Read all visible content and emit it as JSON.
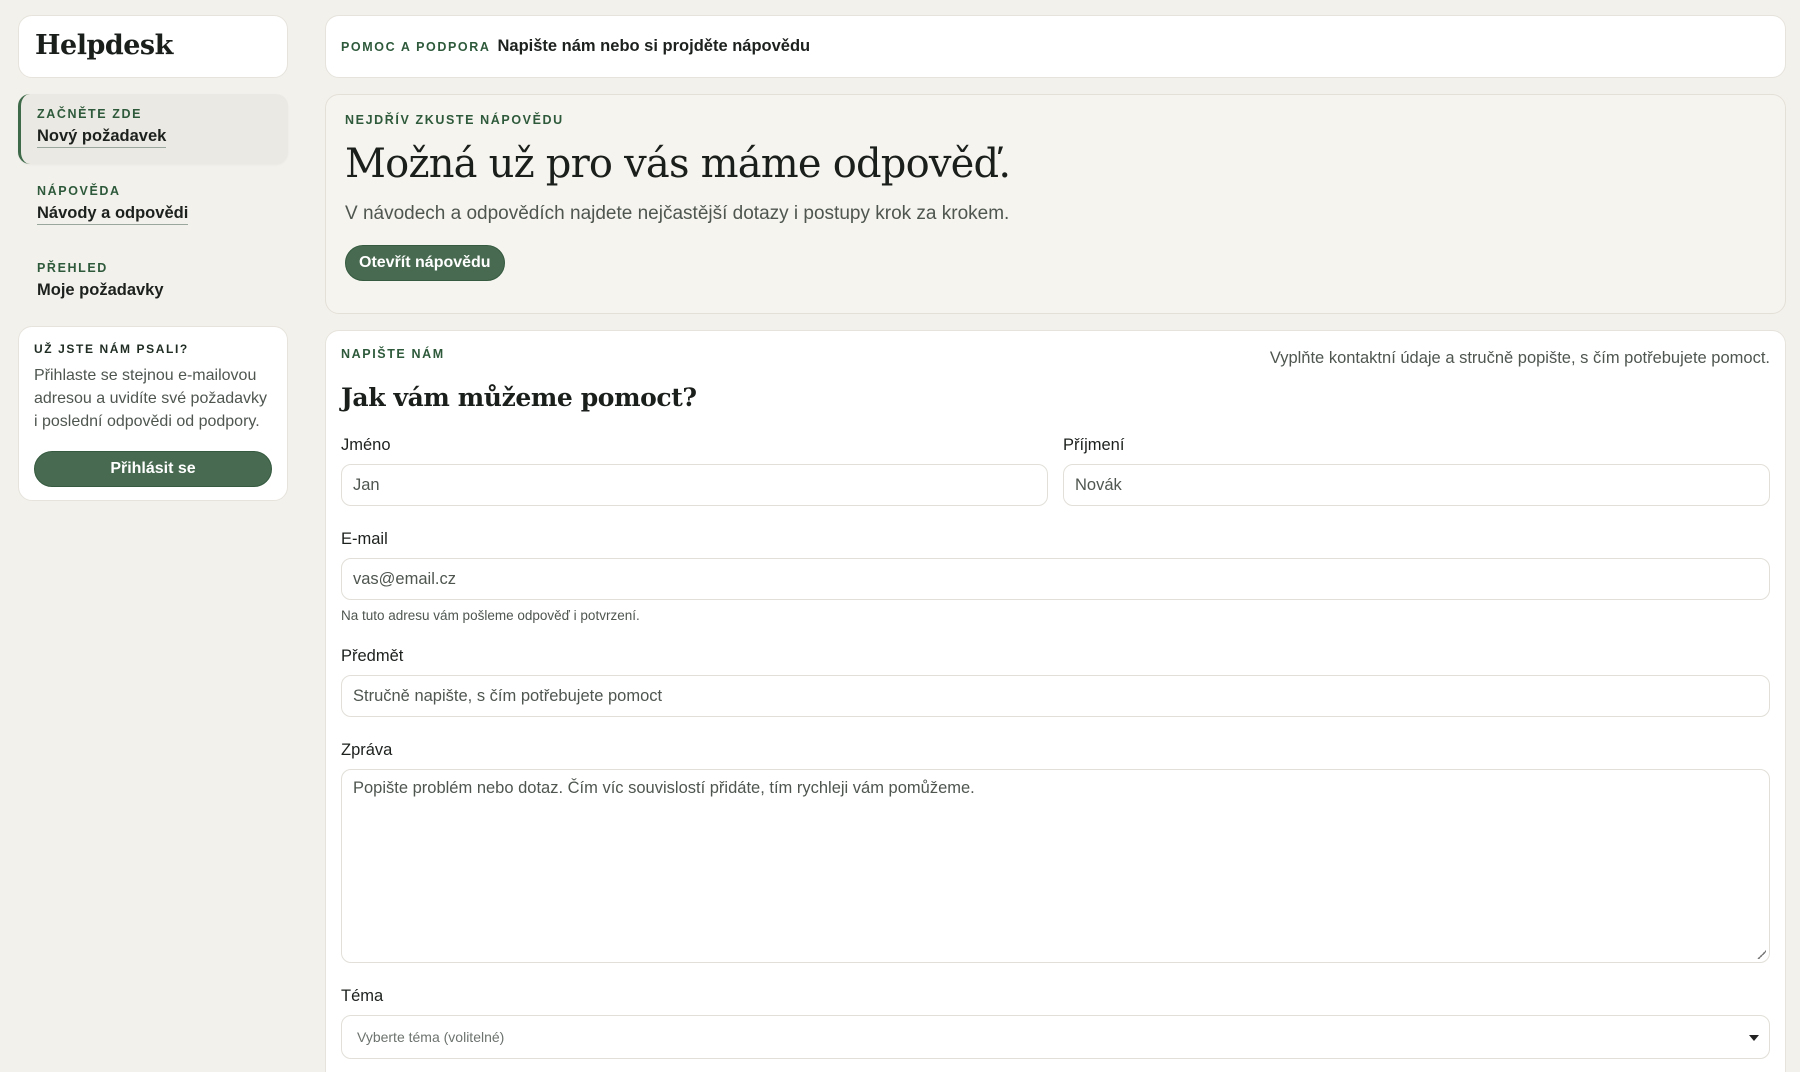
{
  "sidebar": {
    "brand": "Helpdesk",
    "nav": [
      {
        "kicker": "ZAČNĚTE ZDE",
        "label": "Nový požadavek"
      },
      {
        "kicker": "NÁPOVĚDA",
        "label": "Návody a odpovědi"
      },
      {
        "kicker": "PŘEHLED",
        "label": "Moje požadavky"
      }
    ],
    "login": {
      "kicker": "UŽ JSTE NÁM PSALI?",
      "text": "Přihlaste se stejnou e-mailovou adresou a uvidíte své požadavky i poslední odpovědi od podpory.",
      "button": "Přihlásit se"
    }
  },
  "topbar": {
    "kicker": "POMOC A PODPORA",
    "title": "Napište nám nebo si projděte nápovědu"
  },
  "help": {
    "kicker": "NEJDŘÍV ZKUSTE NÁPOVĚDU",
    "title": "Možná už pro vás máme odpověď.",
    "description": "V návodech a odpovědích najdete nejčastější dotazy i postupy krok za krokem.",
    "button": "Otevřít nápovědu"
  },
  "form": {
    "kicker": "NAPIŠTE NÁM",
    "intro": "Vyplňte kontaktní údaje a stručně popište, s čím potřebujete pomoct.",
    "title": "Jak vám můžeme pomoct?",
    "first_name": {
      "label": "Jméno",
      "placeholder": "Jan"
    },
    "last_name": {
      "label": "Příjmení",
      "placeholder": "Novák"
    },
    "email": {
      "label": "E-mail",
      "placeholder": "vas@email.cz",
      "hint": "Na tuto adresu vám pošleme odpověď i potvrzení."
    },
    "subject": {
      "label": "Předmět",
      "placeholder": "Stručně napište, s čím potřebujete pomoct"
    },
    "message": {
      "label": "Zpráva",
      "placeholder": "Popište problém nebo dotaz. Čím víc souvislostí přidáte, tím rychleji vám pomůžeme."
    },
    "topic": {
      "label": "Téma",
      "selected": "Vyberte téma (volitelné)"
    }
  },
  "colors": {
    "accent": "#476a50",
    "kicker": "#2e5a3b",
    "background": "#f3f1ec"
  },
  "icons": {
    "select_caret": "caret-down-icon",
    "textarea_resize": "resize-grip-icon"
  }
}
